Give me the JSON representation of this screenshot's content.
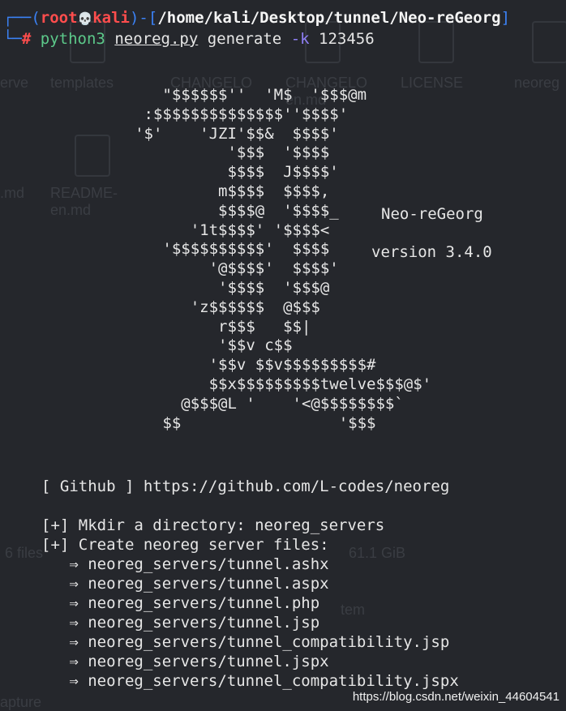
{
  "background": {
    "labels": [
      "erve",
      "templates",
      "CHANGELO",
      "CHANGELO\nen.md",
      "LICENSE",
      "neoreg",
      ".md",
      "README-\nen.md",
      "6 files",
      "61.1 GiB",
      "tem",
      "apture"
    ]
  },
  "prompt": {
    "open": "┌──(",
    "user": "root",
    "skull": "💀",
    "host": "kali",
    "sep": ")-[",
    "path": "/home/kali/Desktop/tunnel/Neo-reGeorg",
    "close": "]",
    "corner": "└─",
    "hash": "#",
    "cmd": "python3",
    "script": "neoreg.py",
    "sub": "generate",
    "flag": "-k",
    "arg": "123456"
  },
  "ascii_art": "          \"$$$$$$''  'M$  '$$$@m\n        :$$$$$$$$$$$$$$''$$$$'\n       '$'    'JZI'$$&  $$$$'\n                 '$$$  '$$$$\n                 $$$$  J$$$$'\n                m$$$$  $$$$,\n                $$$$@  '$$$$_\n             '1t$$$$' '$$$$<\n          '$$$$$$$$$$'  $$$$\n               '@$$$$'  $$$$'\n                '$$$$  '$$$@\n             'z$$$$$$  @$$$\n                r$$$   $$|\n                '$$v c$$\n               '$$v $$v$$$$$$$$$#\n               $$x$$$$$$$$$twelve$$$@$'\n            @$$$@L '    '<@$$$$$$$$`\n          $$                 '$$$",
  "banner": {
    "name": "Neo-reGeorg",
    "version": "version 3.4.0"
  },
  "output": {
    "github": "[ Github ] https://github.com/L-codes/neoreg",
    "mkdir": "[+] Mkdir a directory: neoreg_servers",
    "create": "[+] Create neoreg server files:",
    "files": [
      "   ⇒ neoreg_servers/tunnel.ashx",
      "   ⇒ neoreg_servers/tunnel.aspx",
      "   ⇒ neoreg_servers/tunnel.php",
      "   ⇒ neoreg_servers/tunnel.jsp",
      "   ⇒ neoreg_servers/tunnel_compatibility.jsp",
      "   ⇒ neoreg_servers/tunnel.jspx",
      "   ⇒ neoreg_servers/tunnel_compatibility.jspx"
    ]
  },
  "watermark": "https://blog.csdn.net/weixin_44604541",
  "colors": {
    "background": "#25272c",
    "prompt_frame": "#3b82f6",
    "user": "#ff4d4d",
    "command": "#5cc98a",
    "flag": "#8f7ff5"
  }
}
